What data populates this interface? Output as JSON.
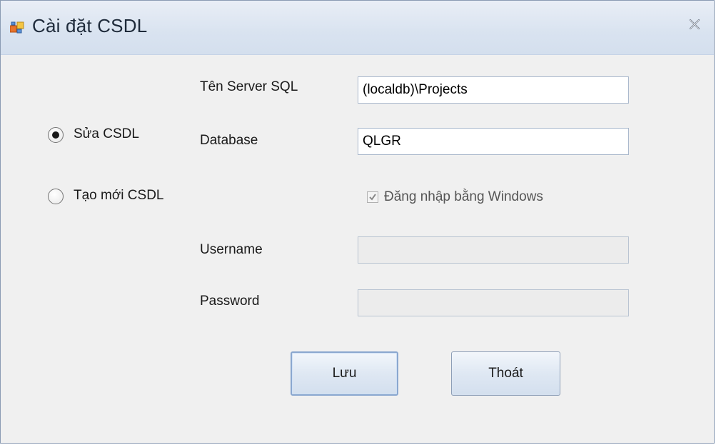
{
  "window": {
    "title": "Cài đặt CSDL",
    "app_icon": "form-icon",
    "close_icon": "close-icon"
  },
  "mode": {
    "edit_label": "Sửa CSDL",
    "edit_selected": true,
    "create_label": "Tạo mới CSDL",
    "create_selected": false
  },
  "form": {
    "server_label": "Tên Server SQL",
    "server_value": "(localdb)\\Projects",
    "database_label": "Database",
    "database_value": "QLGR",
    "windows_auth_label": "Đăng nhập bằng Windows",
    "windows_auth_checked": true,
    "username_label": "Username",
    "username_value": "",
    "password_label": "Password",
    "password_value": ""
  },
  "buttons": {
    "save_label": "Lưu",
    "exit_label": "Thoát"
  }
}
